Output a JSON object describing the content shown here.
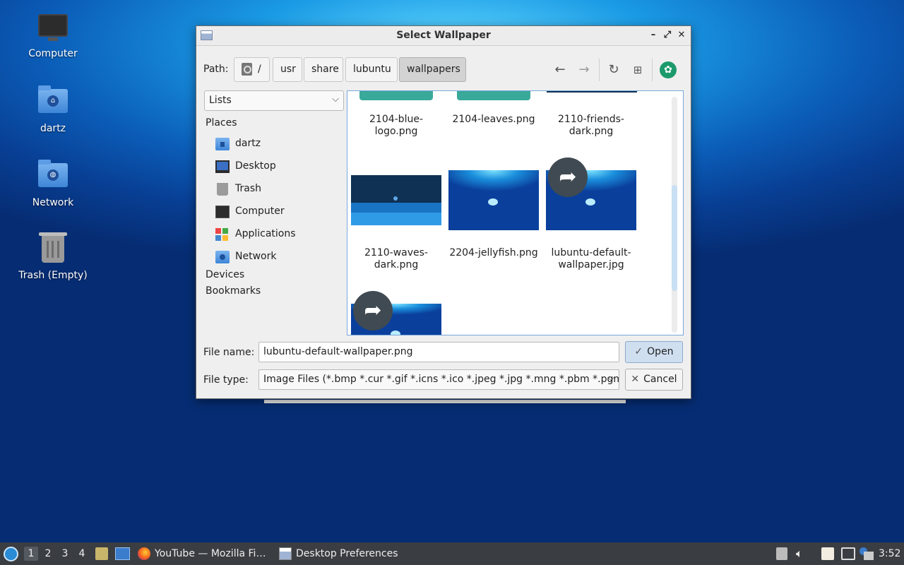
{
  "desktop": {
    "icons": [
      {
        "label": "Computer"
      },
      {
        "label": "dartz"
      },
      {
        "label": "Network"
      },
      {
        "label": "Trash (Empty)"
      }
    ]
  },
  "dialog": {
    "title": "Select Wallpaper",
    "path_label": "Path:",
    "breadcrumbs": [
      "/",
      "usr",
      "share",
      "lubuntu",
      "wallpapers"
    ],
    "active_breadcrumb": "wallpapers",
    "view_mode": "Lists",
    "sidebar": {
      "places_header": "Places",
      "places": [
        "dartz",
        "Desktop",
        "Trash",
        "Computer",
        "Applications",
        "Network"
      ],
      "devices_header": "Devices",
      "bookmarks_header": "Bookmarks"
    },
    "files": [
      {
        "name_line1": "2104-blue-",
        "name_line2": "logo.png"
      },
      {
        "name_line1": "2104-leaves.png",
        "name_line2": ""
      },
      {
        "name_line1": "2110-friends-",
        "name_line2": "dark.png"
      },
      {
        "name_line1": "2110-waves-",
        "name_line2": "dark.png"
      },
      {
        "name_line1": "2204-jellyfish.png",
        "name_line2": ""
      },
      {
        "name_line1": "lubuntu-default-",
        "name_line2": "wallpaper.jpg"
      }
    ],
    "file_name_label": "File name:",
    "file_name_value": "lubuntu-default-wallpaper.png",
    "file_type_label": "File type:",
    "file_type_value": "Image Files (*.bmp *.cur *.gif *.icns *.ico *.jpeg *.jpg *.mng *.pbm *.pgm",
    "open_label": "Open",
    "cancel_label": "Cancel"
  },
  "taskbar": {
    "workspaces": [
      "1",
      "2",
      "3",
      "4"
    ],
    "active_workspace": "1",
    "tasks": [
      {
        "label": "YouTube — Mozilla Fi…",
        "icon": "firefox-icon"
      },
      {
        "label": "Desktop Preferences",
        "icon": "window-icon"
      }
    ],
    "clock": "3:52"
  },
  "colors": {
    "accent": "#79a8dc",
    "taskbar": "#3a3d42",
    "teal_thumb": "#39a99a"
  }
}
